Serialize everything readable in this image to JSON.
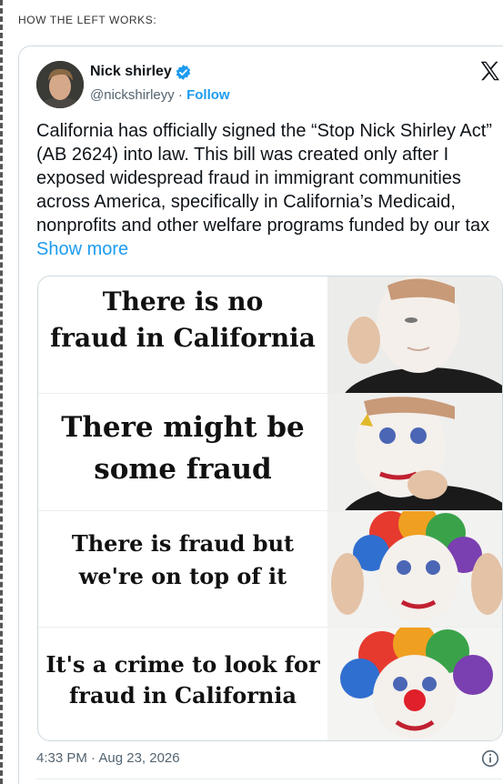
{
  "post": {
    "header": "HOW THE LEFT WORKS:"
  },
  "tweet": {
    "author_name": "Nick shirley",
    "handle": "@nickshirleyy",
    "separator": "·",
    "follow_label": "Follow",
    "text": "California has officially signed the “Stop Nick Shirley Act” (AB 2624) into law. This bill was created only after I exposed widespread fraud in immigrant communities across America, specifically in California’s Medicaid, nonprofits and other welfare programs funded by our tax ",
    "show_more_label": "Show more",
    "timestamp": "4:33 PM · Aug 23, 2026",
    "colors": {
      "link": "#1d9bf0",
      "text": "#0f1419",
      "muted": "#536471",
      "border": "#cfd9de"
    },
    "icons": {
      "verified": "verified-badge-icon",
      "platform": "x-logo-icon",
      "info": "info-icon"
    }
  },
  "meme": {
    "panels": [
      {
        "caption_lines": [
          "There is no",
          "fraud in California"
        ]
      },
      {
        "caption_lines": [
          "There might be",
          "some fraud"
        ]
      },
      {
        "caption_lines": [
          "There is fraud but",
          "we're on top of it"
        ]
      },
      {
        "caption_lines": [
          "It's a crime to look for",
          "fraud in California"
        ]
      }
    ]
  }
}
